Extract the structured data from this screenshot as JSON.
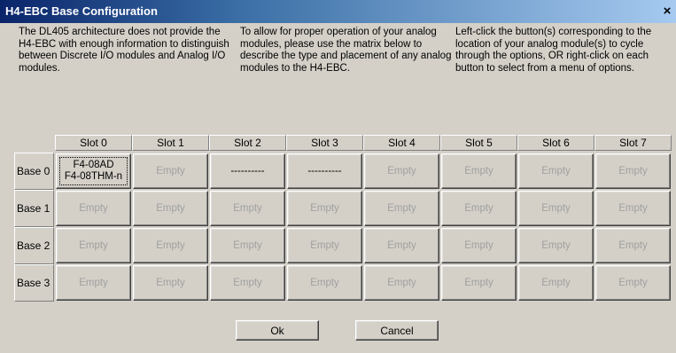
{
  "window": {
    "title": "H4-EBC Base Configuration",
    "close_glyph": "×"
  },
  "instructions": [
    "The DL405 architecture does not provide the H4-EBC with enough information to distinguish between Discrete I/O modules and Analog I/O modules.",
    "To allow for proper operation of your analog modules, please use the matrix below to describe the type and placement of any analog modules to the H4-EBC.",
    "Left-click the button(s) corresponding to the location of your analog module(s) to cycle through the options, OR right-click on each button to select from a menu of options."
  ],
  "grid": {
    "columns": [
      "Slot 0",
      "Slot 1",
      "Slot 2",
      "Slot 3",
      "Slot 4",
      "Slot 5",
      "Slot 6",
      "Slot 7"
    ],
    "rows": [
      {
        "label": "Base 0",
        "cells": [
          {
            "line1": "F4-08AD",
            "line2": "F4-08THM-n",
            "filled": true
          },
          {
            "line1": "Empty"
          },
          {
            "line1": "----------",
            "filled": true
          },
          {
            "line1": "----------",
            "filled": true
          },
          {
            "line1": "Empty"
          },
          {
            "line1": "Empty"
          },
          {
            "line1": "Empty"
          },
          {
            "line1": "Empty"
          }
        ]
      },
      {
        "label": "Base 1",
        "cells": [
          {
            "line1": "Empty"
          },
          {
            "line1": "Empty"
          },
          {
            "line1": "Empty"
          },
          {
            "line1": "Empty"
          },
          {
            "line1": "Empty"
          },
          {
            "line1": "Empty"
          },
          {
            "line1": "Empty"
          },
          {
            "line1": "Empty"
          }
        ]
      },
      {
        "label": "Base 2",
        "cells": [
          {
            "line1": "Empty"
          },
          {
            "line1": "Empty"
          },
          {
            "line1": "Empty"
          },
          {
            "line1": "Empty"
          },
          {
            "line1": "Empty"
          },
          {
            "line1": "Empty"
          },
          {
            "line1": "Empty"
          },
          {
            "line1": "Empty"
          }
        ]
      },
      {
        "label": "Base 3",
        "cells": [
          {
            "line1": "Empty"
          },
          {
            "line1": "Empty"
          },
          {
            "line1": "Empty"
          },
          {
            "line1": "Empty"
          },
          {
            "line1": "Empty"
          },
          {
            "line1": "Empty"
          },
          {
            "line1": "Empty"
          },
          {
            "line1": "Empty"
          }
        ]
      }
    ]
  },
  "buttons": {
    "ok_label": "Ok",
    "cancel_label": "Cancel"
  },
  "colors": {
    "dialog_face": "#d4d0c8",
    "title_start": "#0a246a",
    "title_end": "#a6caf0",
    "empty_text": "#a0a0a0"
  }
}
